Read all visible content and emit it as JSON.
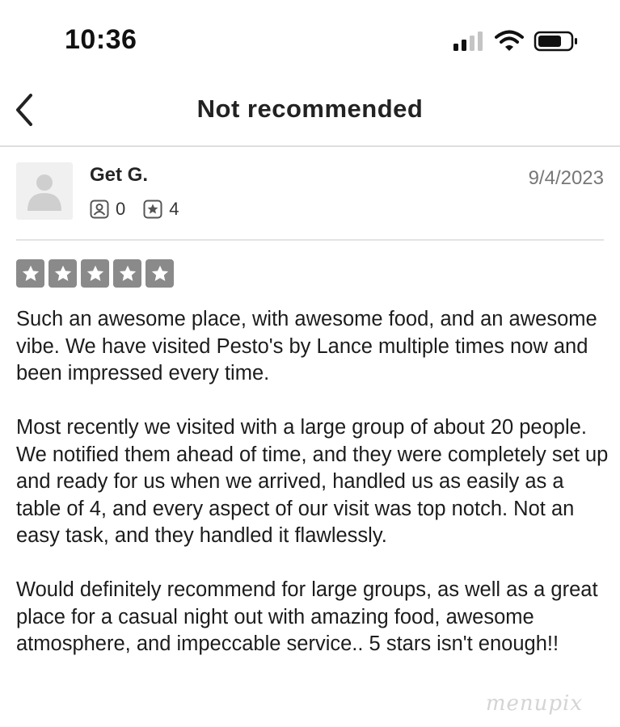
{
  "status_bar": {
    "time": "10:36",
    "signal_icon": "cellular-signal-icon",
    "wifi_icon": "wifi-icon",
    "battery_icon": "battery-icon"
  },
  "navbar": {
    "back_icon": "chevron-left-icon",
    "title": "Not recommended"
  },
  "review": {
    "reviewer_name": "Get G.",
    "date": "9/4/2023",
    "friends_icon": "friends-icon",
    "friends_count": "0",
    "reviews_icon": "star-badge-icon",
    "reviews_count": "4",
    "rating": 5,
    "rating_max": 5,
    "paragraphs": [
      "Such an awesome place, with awesome food, and an awesome vibe. We have visited Pesto's by Lance multiple times now and been impressed every time.",
      "Most recently we visited with a large group of about 20 people. We notified them ahead of time, and they were completely set up and ready for us when we arrived, handled us as easily as a table of 4, and every aspect of our visit was top notch. Not an easy task, and they handled it flawlessly.",
      "Would definitely recommend for large groups,  as well as a great place for a casual night out with amazing food, awesome atmosphere, and impeccable service.. 5 stars isn't enough!!"
    ]
  },
  "watermark": "menupix",
  "colors": {
    "star_fill": "#8a8a8a",
    "text": "#1c1c1c",
    "date": "#777777",
    "divider": "#e3e3e3"
  }
}
